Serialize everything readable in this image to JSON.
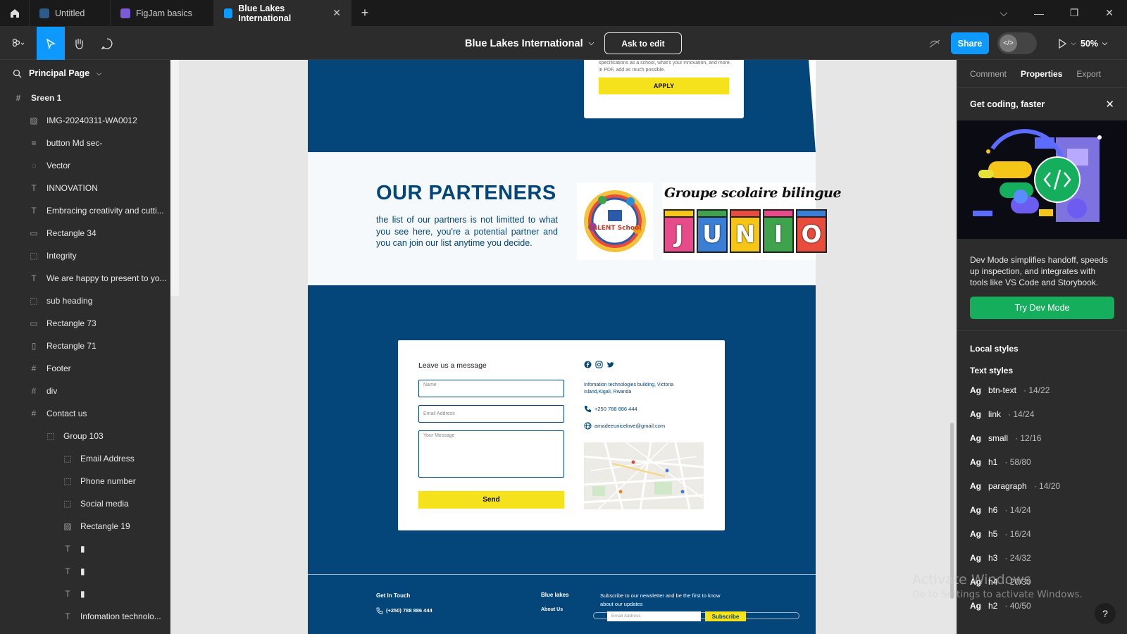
{
  "tabs": [
    {
      "label": "Untitled",
      "color": "#2c5d8a"
    },
    {
      "label": "FigJam basics",
      "color": "#7b5cd6"
    },
    {
      "label": "Blue Lakes International",
      "color": "#0d99ff"
    }
  ],
  "toolbar": {
    "file_name": "Blue Lakes International",
    "ask_to_edit": "Ask to edit",
    "share": "Share",
    "zoom": "50%"
  },
  "layers": {
    "page": "Principal Page",
    "items": [
      {
        "label": "Sreen 1",
        "icon": "frame-icon",
        "glyph": "#",
        "level": 0
      },
      {
        "label": "IMG-20240311-WA0012",
        "icon": "image-icon",
        "glyph": "▨",
        "level": 1
      },
      {
        "label": "button Md sec-",
        "icon": "component-icon",
        "glyph": "≡",
        "level": 1
      },
      {
        "label": "Vector",
        "icon": "vector-icon",
        "glyph": "◌",
        "level": 1
      },
      {
        "label": "INNOVATION",
        "icon": "text-icon",
        "glyph": "T",
        "level": 1
      },
      {
        "label": "Embracing creativity and cutti...",
        "icon": "text-icon",
        "glyph": "T",
        "level": 1
      },
      {
        "label": "Rectangle 34",
        "icon": "rectangle-icon",
        "glyph": "▭",
        "level": 1
      },
      {
        "label": "Integrity",
        "icon": "group-icon",
        "glyph": "⬚",
        "level": 1
      },
      {
        "label": "We are happy to present to yo...",
        "icon": "text-icon",
        "glyph": "T",
        "level": 1
      },
      {
        "label": "sub heading",
        "icon": "group-icon",
        "glyph": "⬚",
        "level": 1
      },
      {
        "label": "Rectangle 73",
        "icon": "rectangle-icon",
        "glyph": "▭",
        "level": 1
      },
      {
        "label": "Rectangle 71",
        "icon": "rectangle-icon",
        "glyph": "▯",
        "level": 1
      },
      {
        "label": "Footer",
        "icon": "frame-icon",
        "glyph": "#",
        "level": 1
      },
      {
        "label": "div",
        "icon": "frame-icon",
        "glyph": "#",
        "level": 1
      },
      {
        "label": "Contact us",
        "icon": "frame-icon",
        "glyph": "#",
        "level": 1
      },
      {
        "label": "Group 103",
        "icon": "group-icon",
        "glyph": "⬚",
        "level": 2
      },
      {
        "label": "Email Address",
        "icon": "group-icon",
        "glyph": "⬚",
        "level": 3
      },
      {
        "label": "Phone number",
        "icon": "group-icon",
        "glyph": "⬚",
        "level": 3
      },
      {
        "label": "Social media",
        "icon": "group-icon",
        "glyph": "⬚",
        "level": 3
      },
      {
        "label": "Rectangle 19",
        "icon": "image-icon",
        "glyph": "▨",
        "level": 3
      },
      {
        "label": "▮",
        "icon": "text-icon",
        "glyph": "T",
        "level": 3
      },
      {
        "label": "▮",
        "icon": "text-icon",
        "glyph": "T",
        "level": 3
      },
      {
        "label": "▮",
        "icon": "text-icon",
        "glyph": "T",
        "level": 3
      },
      {
        "label": "Infomation technolo...",
        "icon": "text-icon",
        "glyph": "T",
        "level": 3
      }
    ]
  },
  "design": {
    "apply_text": "specifications as a school, what's your innovation, and more. in PDF, add as much possible.",
    "apply_button": "APPLY",
    "partners_title": "OUR PARTENERS",
    "partners_desc": "the list of our partners is not limitted to what you see here, you're a potential partner and you can join our list anytime you decide.",
    "talent_logo_text": "TALENT School",
    "junior_title": "Groupe scolaire bilingue",
    "junior_letters": [
      "J",
      "U",
      "N",
      "I",
      "O"
    ],
    "contact_title": "Leave us a message",
    "name_placeholder": "Name",
    "email_placeholder": "Email Address",
    "message_placeholder": "Your Message",
    "send_button": "Send",
    "address": "Infomation technologies building, Victoria Island,Kigali, Rwanda",
    "phone": "+250 788 886 444",
    "email": "amadeeunicekwe@gmail.com",
    "footer": {
      "get_in_touch": "Get In Touch",
      "phone": "(+250) 788 886 444",
      "blue_lakes": "Blue lakes",
      "about_us": "About Us",
      "newsletter": "Subscribe to our newsletter and be the first to know about our updates",
      "email_placeholder": "Email Address",
      "subscribe": "Subscribe"
    }
  },
  "right_panel": {
    "tabs": [
      "Comment",
      "Properties",
      "Export"
    ],
    "get_coding": "Get coding, faster",
    "dev_desc": "Dev Mode simplifies handoff, speeds up inspection, and integrates with tools like VS Code and Storybook.",
    "try_dev_mode": "Try Dev Mode",
    "local_styles": "Local styles",
    "text_styles": "Text styles",
    "styles": [
      {
        "ag": "Ag",
        "name": "btn-text",
        "meta": "· 14/22"
      },
      {
        "ag": "Ag",
        "name": "link",
        "meta": "· 14/24"
      },
      {
        "ag": "Ag",
        "name": "small",
        "meta": "· 12/16"
      },
      {
        "ag": "Ag",
        "name": "h1",
        "meta": "· 58/80"
      },
      {
        "ag": "Ag",
        "name": "paragraph",
        "meta": "· 14/20"
      },
      {
        "ag": "Ag",
        "name": "h6",
        "meta": "· 14/24"
      },
      {
        "ag": "Ag",
        "name": "h5",
        "meta": "· 16/24"
      },
      {
        "ag": "Ag",
        "name": "h3",
        "meta": "· 24/32"
      },
      {
        "ag": "Ag",
        "name": "h4",
        "meta": "· 20/30"
      },
      {
        "ag": "Ag",
        "name": "h2",
        "meta": "· 40/50"
      }
    ],
    "help": "?"
  },
  "watermark": {
    "line1": "Activate Windows",
    "line2": "Go to Settings to activate Windows."
  },
  "colors": {
    "brand_blue": "#04467a",
    "accent_yellow": "#f5e11c",
    "figma_blue": "#0d99ff",
    "dev_green": "#14ae5c"
  }
}
